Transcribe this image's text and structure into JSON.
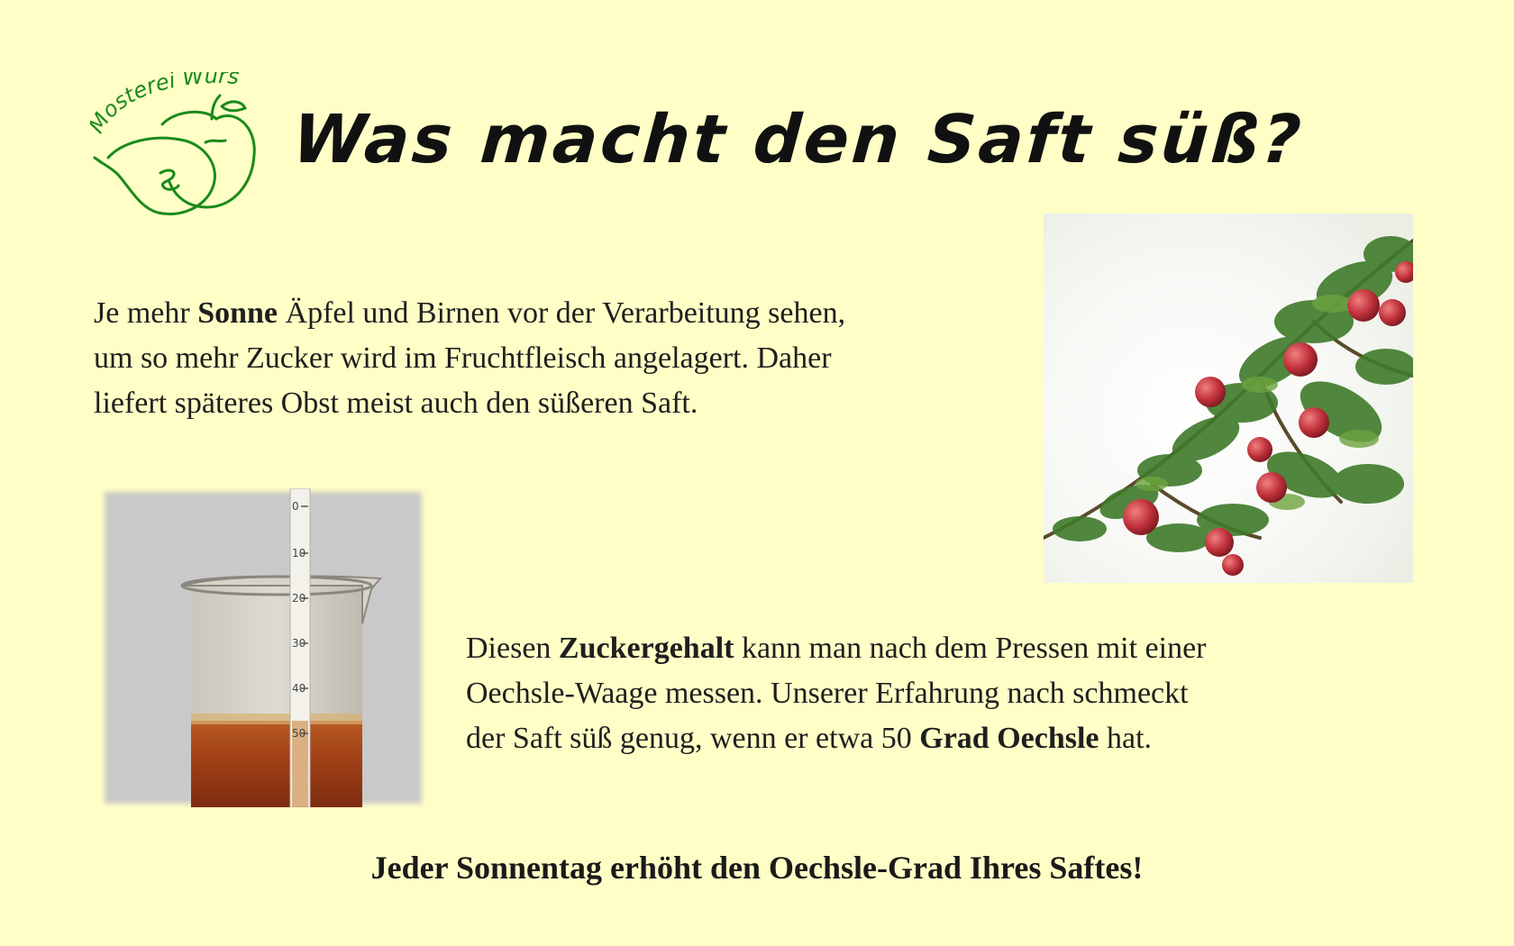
{
  "logo": {
    "text": "Mosterei Wurst",
    "icon": "apple-pear-logo-icon",
    "color": "#1a8a1a"
  },
  "title": "Was macht den Saft süß?",
  "paragraph1": {
    "pre": "Je mehr ",
    "bold": "Sonne",
    "line1_rest": " Äpfel und Birnen vor der Verarbeitung sehen,",
    "line2": "um so mehr Zucker wird im Fruchtfleisch angelagert. Daher",
    "line3": "liefert späteres Obst meist auch den süßeren Saft."
  },
  "paragraph2": {
    "pre": "Diesen ",
    "bold1": "Zuckergehalt",
    "line1_rest": " kann man nach dem Pressen mit einer",
    "line2": "Oechsle-Waage messen. Unserer Erfahrung nach schmeckt",
    "line3_pre": "der Saft süß genug, wenn er etwa 50 ",
    "bold2": "Grad Oechsle",
    "line3_post": " hat."
  },
  "images": {
    "tree": "apple-tree-branch-photo",
    "cylinder": "hydrometer-measuring-cup-photo",
    "scale_ticks": [
      "0",
      "10",
      "20",
      "30",
      "40",
      "50"
    ]
  },
  "footer": "Jeder Sonnentag erhöht den Oechsle-Grad Ihres Saftes!",
  "colors": {
    "background": "#fefec6",
    "logo_green": "#1a8a1a",
    "juice": "#a0461a"
  }
}
